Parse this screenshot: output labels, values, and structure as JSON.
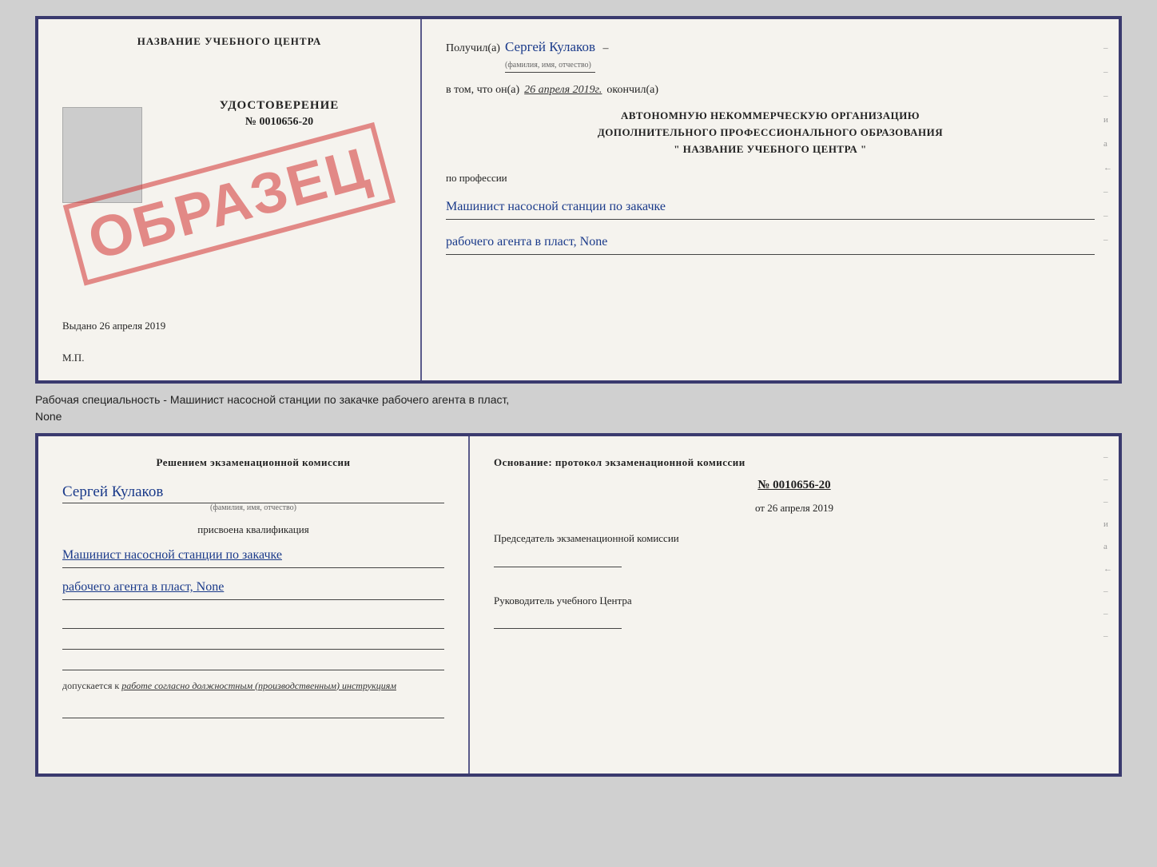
{
  "page": {
    "background": "#d0d0d0"
  },
  "top_doc": {
    "left": {
      "school_name": "НАЗВАНИЕ УЧЕБНОГО ЦЕНТРА",
      "stamp_text": "ОБРАЗЕЦ",
      "udostoverenie_label": "УДОСТОВЕРЕНИЕ",
      "doc_number": "№ 0010656-20",
      "issued_date_label": "Выдано",
      "issued_date_value": "26 апреля 2019",
      "mp_label": "М.П."
    },
    "right": {
      "received_prefix": "Получил(а)",
      "received_name": "Сергей Кулаков",
      "received_hint": "(фамилия, имя, отчество)",
      "date_prefix": "в том, что он(а)",
      "date_value": "26 апреля 2019г.",
      "date_suffix": "окончил(а)",
      "org_line1": "АВТОНОМНУЮ НЕКОММЕРЧЕСКУЮ ОРГАНИЗАЦИЮ",
      "org_line2": "ДОПОЛНИТЕЛЬНОГО ПРОФЕССИОНАЛЬНОГО ОБРАЗОВАНИЯ",
      "org_line3": "\"  НАЗВАНИЕ УЧЕБНОГО ЦЕНТРА  \"",
      "profession_prefix": "по профессии",
      "profession_line1": "Машинист насосной станции по закачке",
      "profession_line2": "рабочего агента в пласт, None",
      "side_marks": [
        "-",
        "-",
        "-",
        "и",
        "а",
        "←",
        "-",
        "-",
        "-"
      ]
    }
  },
  "caption": {
    "text": "Рабочая специальность - Машинист насосной станции по закачке рабочего агента в пласт,",
    "text2": "None"
  },
  "bottom_doc": {
    "left": {
      "commission_text": "Решением экзаменационной комиссии",
      "name": "Сергей Кулаков",
      "name_hint": "(фамилия, имя, отчество)",
      "assigned_label": "присвоена квалификация",
      "qual_line1": "Машинист насосной станции по закачке",
      "qual_line2": "рабочего агента в пласт, None",
      "допускается_prefix": "допускается к",
      "допускается_text": "работе согласно должностным (производственным) инструкциям"
    },
    "right": {
      "osnov_text": "Основание: протокол экзаменационной комиссии",
      "protocol_number": "№ 0010656-20",
      "from_prefix": "от",
      "from_date": "26 апреля 2019",
      "chairman_label": "Председатель экзаменационной комиссии",
      "head_label": "Руководитель учебного Центра",
      "side_marks": [
        "-",
        "-",
        "-",
        "и",
        "а",
        "←",
        "-",
        "-",
        "-"
      ]
    }
  }
}
